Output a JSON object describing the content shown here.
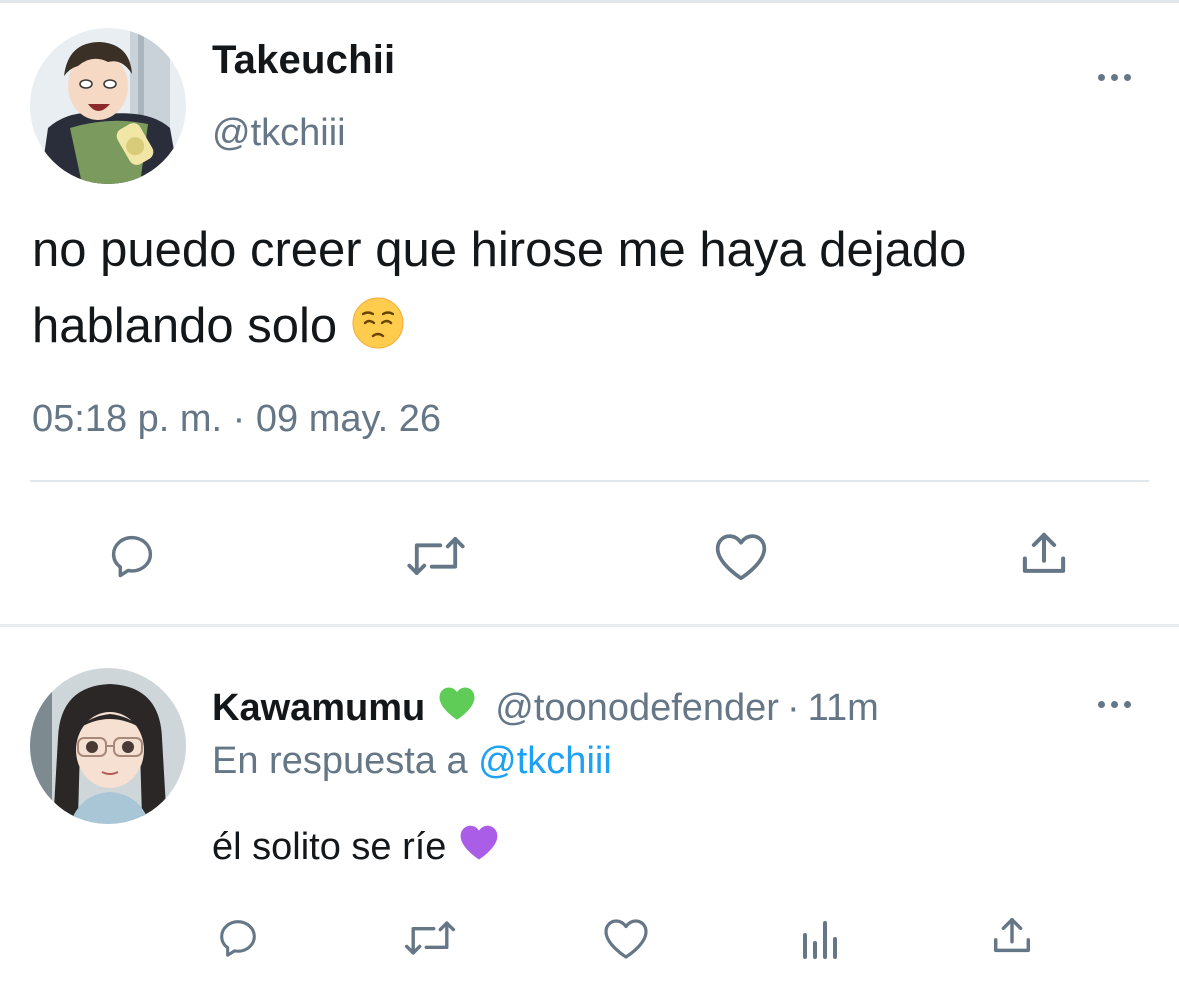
{
  "main_tweet": {
    "display_name": "Takeuchii",
    "handle": "@tkchiii",
    "text": "no puedo creer que hirose me haya dejado hablando solo",
    "emoji": "pensive-face",
    "timestamp": "05:18 p. m. · 09 may. 26",
    "actions": [
      "reply-icon",
      "retweet-icon",
      "like-icon",
      "share-icon"
    ]
  },
  "reply_tweet": {
    "display_name": "Kawamumu",
    "name_emoji": "green-heart",
    "handle": "@toonodefender",
    "separator": "·",
    "time": "11m",
    "reply_prefix": "En respuesta a",
    "reply_mention": "@tkchiii",
    "text": "él solito se ríe",
    "text_emoji": "purple-heart",
    "actions": [
      "reply-icon",
      "retweet-icon",
      "like-icon",
      "analytics-icon",
      "share-icon"
    ]
  },
  "colors": {
    "text_primary": "#14171a",
    "text_secondary": "#657786",
    "link": "#1da1f2",
    "divider": "#e1e8ed",
    "icon": "#657786"
  }
}
